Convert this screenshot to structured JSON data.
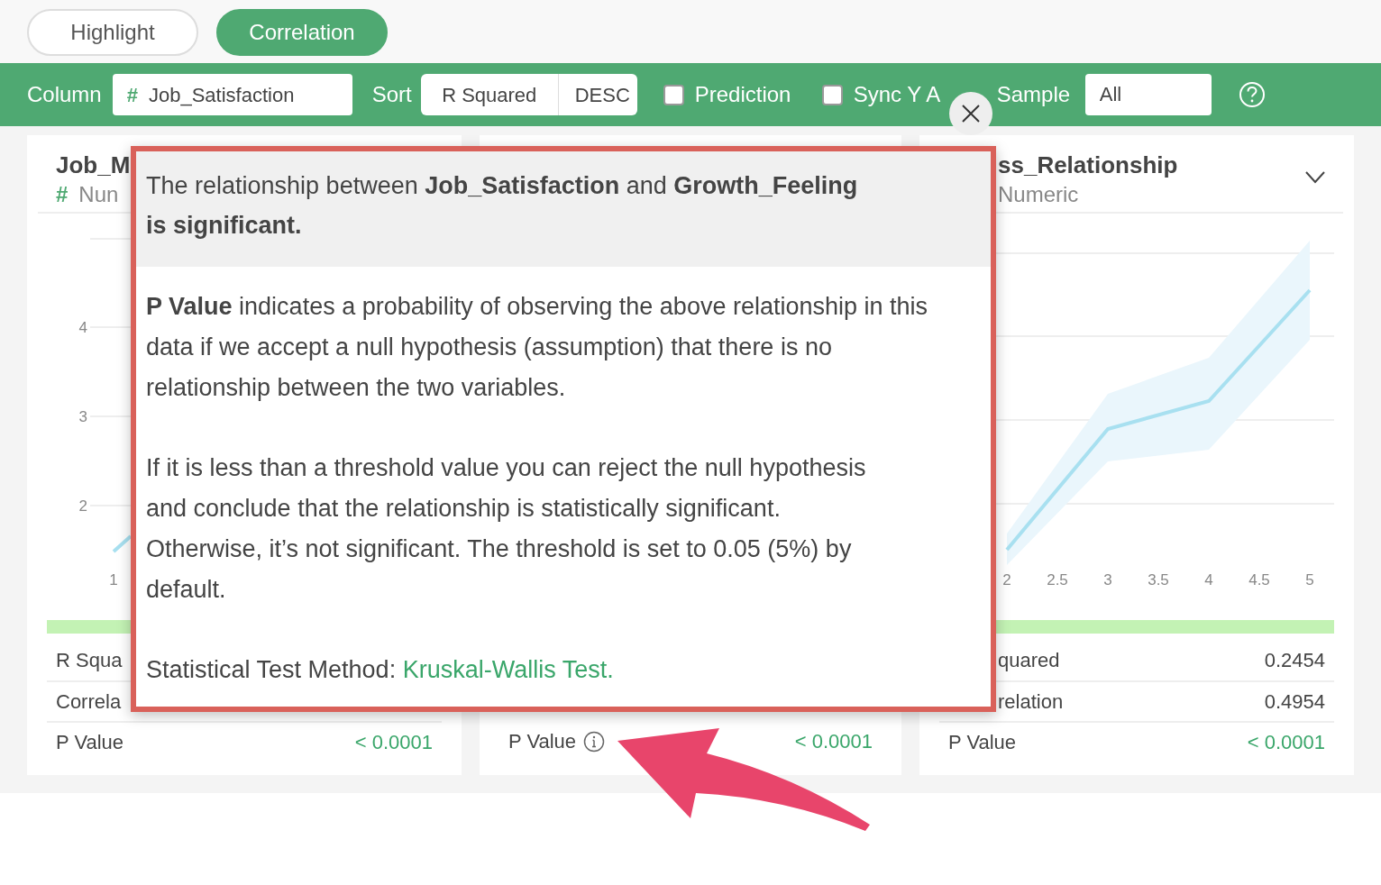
{
  "tabs": [
    {
      "label": "Highlight",
      "selected": false
    },
    {
      "label": "Correlation",
      "selected": true
    }
  ],
  "toolbar": {
    "column_label": "Column",
    "column_symbol": "#",
    "column_value": "Job_Satisfaction",
    "sort_label": "Sort",
    "sort_by": "R Squared",
    "sort_order": "DESC",
    "checkboxes": [
      {
        "label": "Prediction",
        "checked": false
      },
      {
        "label": "Sync Y A",
        "checked": false
      }
    ],
    "sample_label": "Sample",
    "sample_value": "All"
  },
  "cards": [
    {
      "title": "Job_M",
      "type_symbol": "#",
      "type_label": "Nun",
      "dropdown": false,
      "chart": {
        "y_ticks": [
          "4",
          "3",
          "2"
        ],
        "x_ticks": [
          "1"
        ]
      },
      "stats": [
        {
          "label": "R Squa",
          "kind": "number",
          "info_icon": false
        },
        {
          "label": "Correla",
          "kind": "number",
          "info_icon": false
        },
        {
          "label": "P Value",
          "value": "< 0.0001",
          "kind": "p_value",
          "info_icon": false
        }
      ]
    },
    {
      "stats": [
        {
          "label": "P Value",
          "value": "< 0.0001",
          "kind": "p_value",
          "info_icon": true
        }
      ]
    },
    {
      "title": "ss_Relationship",
      "type_label": "Numeric",
      "dropdown": true,
      "chart": {
        "x_ticks": [
          "2",
          "2.5",
          "3",
          "3.5",
          "4",
          "4.5",
          "5"
        ]
      },
      "stats": [
        {
          "label": "quared",
          "value": "0.2454",
          "kind": "number",
          "info_icon": false
        },
        {
          "label": "relation",
          "value": "0.4954",
          "kind": "number",
          "info_icon": false
        },
        {
          "label": "P Value",
          "value": "< 0.0001",
          "kind": "p_value",
          "info_icon": false
        }
      ]
    }
  ],
  "popover": {
    "header": "The relationship between **Job_Satisfaction** and **Growth_Feeling** **is significant.**",
    "paragraphs": [
      "**P Value** indicates a probability of observing the above relationship in this data if we accept a null hypothesis (assumption) that there is no relationship between the two variables.",
      "If it is less than a threshold value you can reject the null hypothesis and conclude that the relationship is statistically significant. Otherwise, it’s not significant. The threshold is set to 0.05 (5%) by default."
    ],
    "method_label": "Statistical Test Method:",
    "method_link": "Kruskal-Wallis Test."
  }
}
